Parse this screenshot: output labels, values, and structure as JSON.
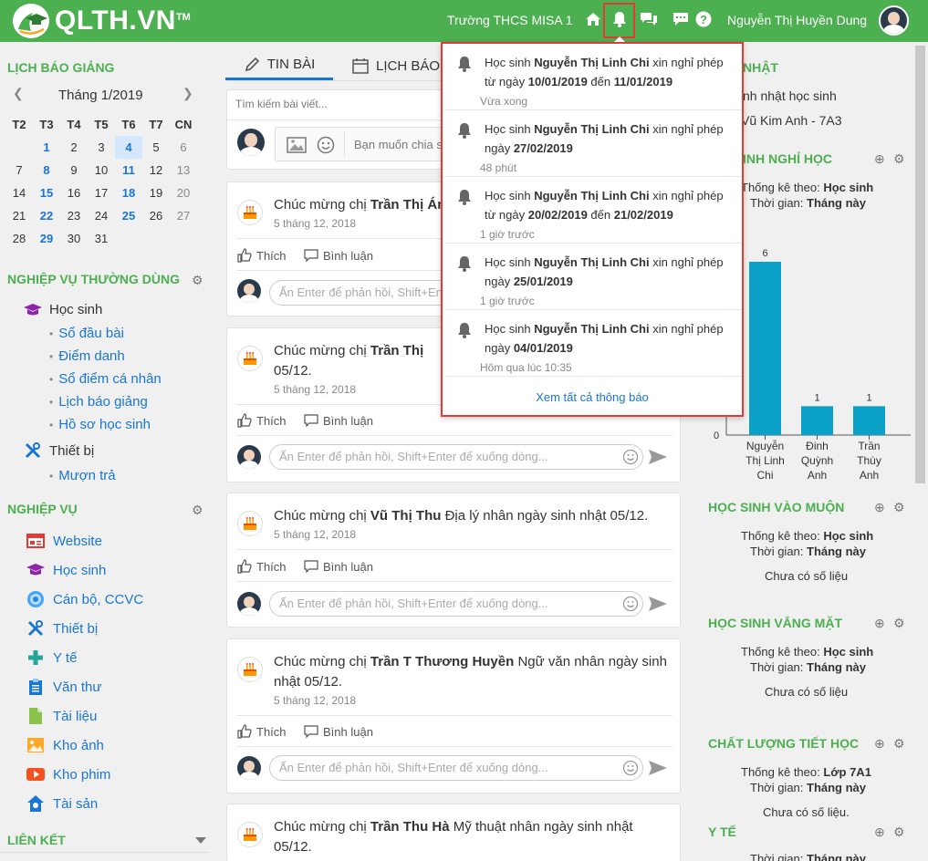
{
  "brand": {
    "name": "QLTH.VN",
    "tm": "TM"
  },
  "header": {
    "school": "Trường THCS MISA 1",
    "user": "Nguyễn Thị Huyền Dung"
  },
  "calendar": {
    "title": "LỊCH BÁO GIẢNG",
    "month": "Tháng 1/2019",
    "weekdays": [
      "T2",
      "T3",
      "T4",
      "T5",
      "T6",
      "T7",
      "CN"
    ],
    "weeks": [
      [
        "",
        "1",
        "2",
        "3",
        "4",
        "5",
        "6"
      ],
      [
        "7",
        "8",
        "9",
        "10",
        "11",
        "12",
        "13"
      ],
      [
        "14",
        "15",
        "16",
        "17",
        "18",
        "19",
        "20"
      ],
      [
        "21",
        "22",
        "23",
        "24",
        "25",
        "26",
        "27"
      ],
      [
        "28",
        "29",
        "30",
        "31",
        "",
        "",
        ""
      ]
    ]
  },
  "common": {
    "title": "NGHIỆP VỤ THƯỜNG DÙNG",
    "group1": "Học sinh",
    "items1": [
      "Sổ đầu bài",
      "Điểm danh",
      "Sổ điểm cá nhân",
      "Lịch báo giảng",
      "Hồ sơ học sinh"
    ],
    "group2": "Thiết bị",
    "items2": [
      "Mượn trả"
    ]
  },
  "business": {
    "title": "NGHIỆP VỤ",
    "items": [
      "Website",
      "Học sinh",
      "Cán bộ, CCVC",
      "Thiết bị",
      "Y tế",
      "Văn thư",
      "Tài liệu",
      "Kho ảnh",
      "Kho phim",
      "Tài sản"
    ]
  },
  "links": {
    "title": "LIÊN KẾT"
  },
  "tabs": [
    "TIN BÀI",
    "LỊCH BÁO"
  ],
  "composer": {
    "search": "Tìm kiếm bài viết...",
    "placeholder": "Bạn muốn chia s"
  },
  "actions": {
    "like": "Thích",
    "comment": "Bình luận",
    "reply": "Ấn Enter để phản hồi, Shift+Enter để xuống dòng...",
    "reply_short": "Ấn Enter để phản hồi, Shift+Ent"
  },
  "posts": [
    {
      "pre": "Chúc mừng chị ",
      "name": "Trần Thị Ánh",
      "post": "",
      "date": "5 tháng 12, 2018"
    },
    {
      "pre": "Chúc mừng chị ",
      "name": "Trần Thị",
      "post": "",
      "line2": "05/12.",
      "date": "5 tháng 12, 2018"
    },
    {
      "pre": "Chúc mừng chị ",
      "name": "Vũ Thị Thu",
      "post": " Địa lý nhân ngày sinh nhật 05/12.",
      "date": "5 tháng 12, 2018"
    },
    {
      "pre": "Chúc mừng chị ",
      "name": "Trần T Thương Huyền",
      "post": " Ngữ văn nhân ngày sinh",
      "line2": "nhật 05/12.",
      "date": "5 tháng 12, 2018"
    },
    {
      "pre": "Chúc mừng chị ",
      "name": "Trần Thu Hà",
      "post": " Mỹ thuật nhân ngày sinh nhật",
      "line2": "05/12.",
      "date": "5 tháng 12, 2018"
    }
  ],
  "right": {
    "birthday_title": "NHẬT",
    "birthday_line1": "nh nhật học sinh",
    "birthday_line2": "Vũ Kim Anh - 7A3",
    "leave_title": "INH NGHỈ HỌC",
    "stat_by": "Thống kê theo: ",
    "stat_by_val": "Học sinh",
    "time": "Thời gian: ",
    "time_val": "Tháng này",
    "late_title": "HỌC SINH VÀO MUỘN",
    "absent_title": "HỌC SINH VẮNG MẶT",
    "quality_title": "CHẤT LƯỢNG TIẾT HỌC",
    "quality_by_val": "Lớp 7A1",
    "health_title": "Y TẾ",
    "no_data": "Chưa có số liệu",
    "no_data_dot": "Chưa có số liệu."
  },
  "chart_data": {
    "type": "bar",
    "categories": [
      "Nguyễn Thị Linh Chi",
      "Đinh Quỳnh Anh",
      "Trần Thùy Anh"
    ],
    "category_lines": [
      [
        "Nguyễn",
        "Thị Linh",
        "Chi"
      ],
      [
        "Đinh",
        "Quỳnh",
        "Anh"
      ],
      [
        "Trần",
        "Thùy",
        "Anh"
      ]
    ],
    "values": [
      6,
      1,
      1
    ],
    "ylim": [
      0,
      6
    ],
    "y_tick": "0",
    "bar_color": "#0aa0c8"
  },
  "notifications": [
    {
      "pre": "Học sinh ",
      "name": "Nguyễn Thị Linh Chi",
      "mid": " xin nghỉ phép từ ngày ",
      "d1": "10/01/2019",
      "sep": " đến ",
      "d2": "11/01/2019",
      "time": "Vừa xong"
    },
    {
      "pre": "Học sinh ",
      "name": "Nguyễn Thị Linh Chi",
      "mid": " xin nghỉ phép ngày ",
      "d1": "27/02/2019",
      "sep": "",
      "d2": "",
      "time": "48 phút"
    },
    {
      "pre": "Học sinh ",
      "name": "Nguyễn Thị Linh Chi",
      "mid": " xin nghỉ phép từ ngày ",
      "d1": "20/02/2019",
      "sep": " đến ",
      "d2": "21/02/2019",
      "time": "1 giờ trước"
    },
    {
      "pre": "Học sinh ",
      "name": "Nguyễn Thị Linh Chi",
      "mid": " xin nghỉ phép ngày ",
      "d1": "25/01/2019",
      "sep": "",
      "d2": "",
      "time": "1 giờ trước"
    },
    {
      "pre": "Học sinh ",
      "name": "Nguyễn Thị Linh Chi",
      "mid": " xin nghỉ phép ngày ",
      "d1": "04/01/2019",
      "sep": "",
      "d2": "",
      "time": "Hôm qua lúc 10:35"
    }
  ],
  "see_all": "Xem tất cả thông báo",
  "colors": {
    "primary": "#4caf50",
    "link": "#1976d2",
    "highlight": "#e53935"
  }
}
